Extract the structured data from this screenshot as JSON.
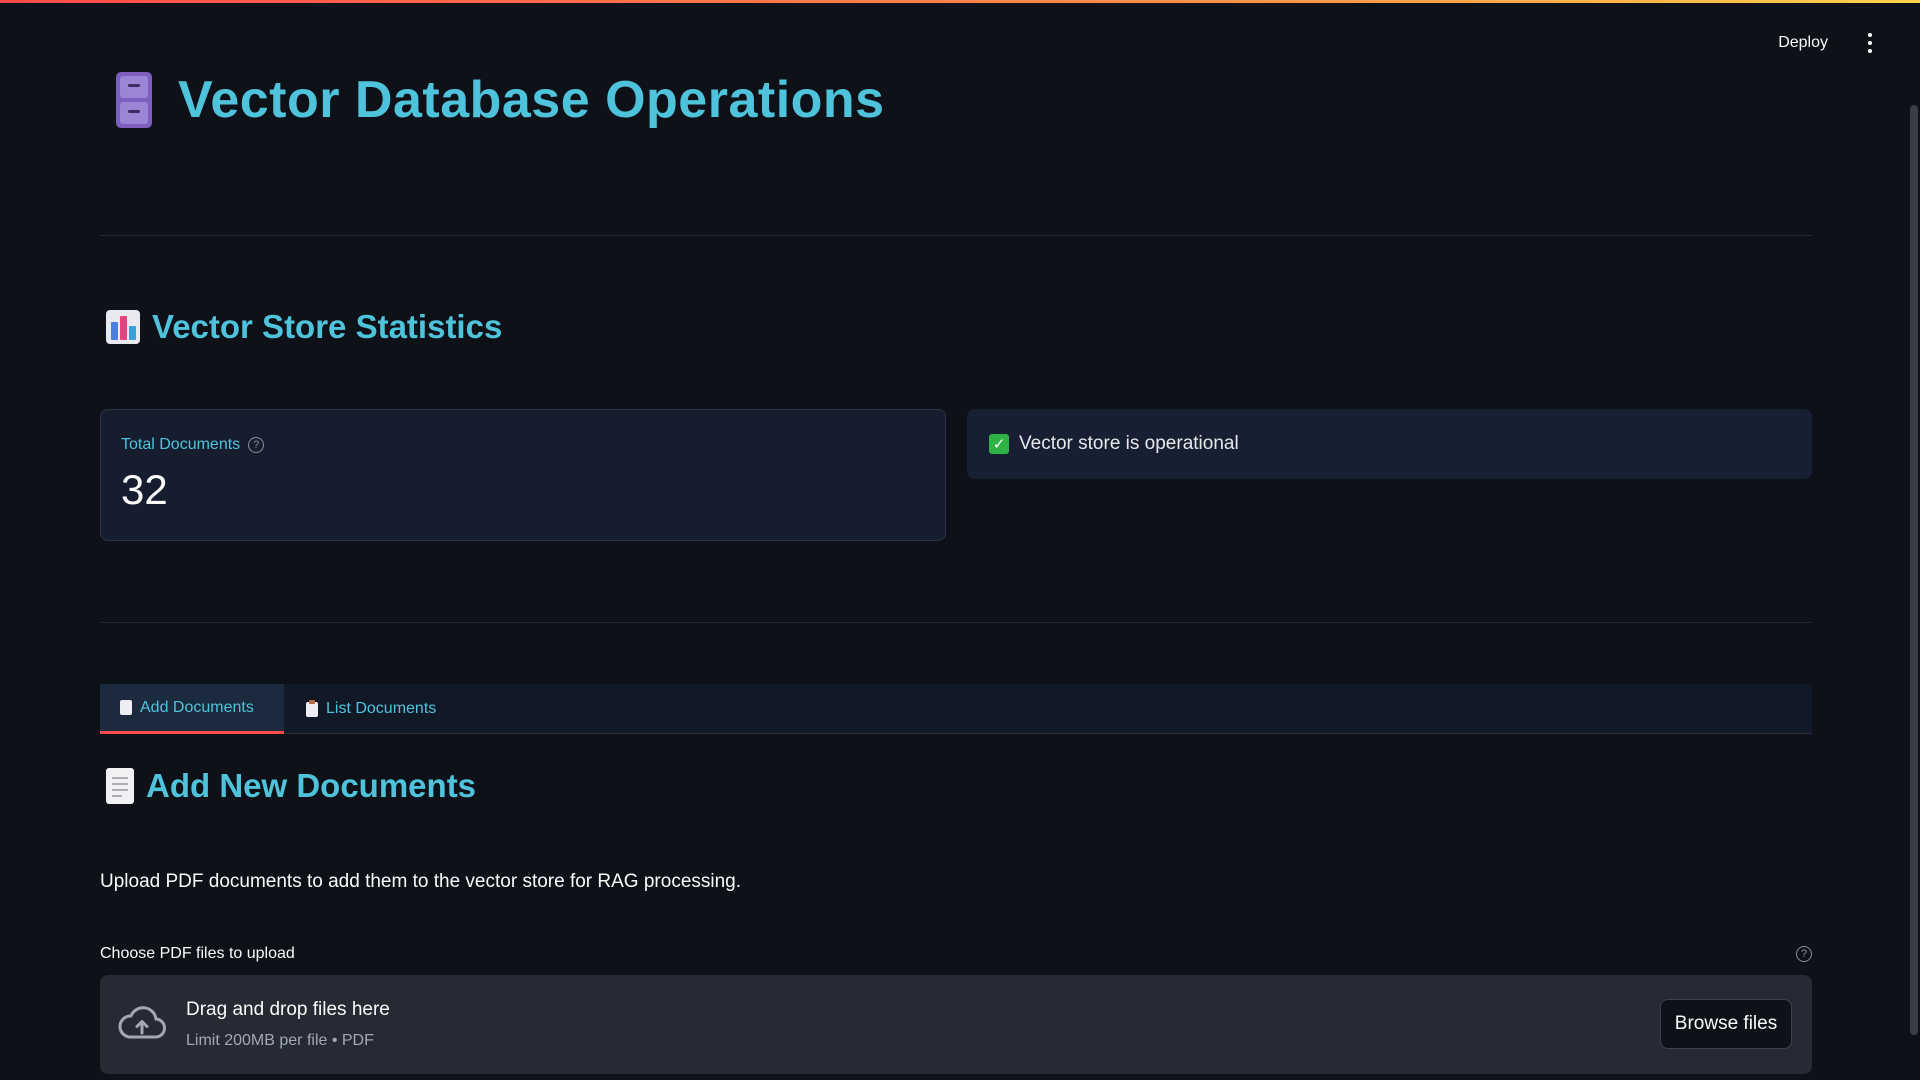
{
  "header": {
    "deploy_label": "Deploy",
    "menu_icon": "more-vertical-icon"
  },
  "page": {
    "title": "Vector Database Operations",
    "title_icon": "file-cabinet-icon"
  },
  "stats": {
    "heading": "Vector Store Statistics",
    "heading_icon": "bar-chart-icon",
    "metric_label": "Total Documents",
    "metric_value": "32",
    "status_text": "Vector store is operational",
    "status_icon": "check-mark-button-icon"
  },
  "tabs": [
    {
      "label": "Add Documents",
      "icon": "page-facing-up-icon",
      "active": true
    },
    {
      "label": "List Documents",
      "icon": "clipboard-icon",
      "active": false
    }
  ],
  "add_section": {
    "heading": "Add New Documents",
    "heading_icon": "page-facing-up-icon",
    "description": "Upload PDF documents to add them to the vector store for RAG processing.",
    "uploader_label": "Choose PDF files to upload",
    "drop_title": "Drag and drop files here",
    "drop_subtitle": "Limit 200MB per file • PDF",
    "browse_label": "Browse files"
  },
  "colors": {
    "accent": "#4fc3dc",
    "background": "#0e1117",
    "tab_indicator": "#ff4b4b",
    "success": "#2fb344"
  }
}
